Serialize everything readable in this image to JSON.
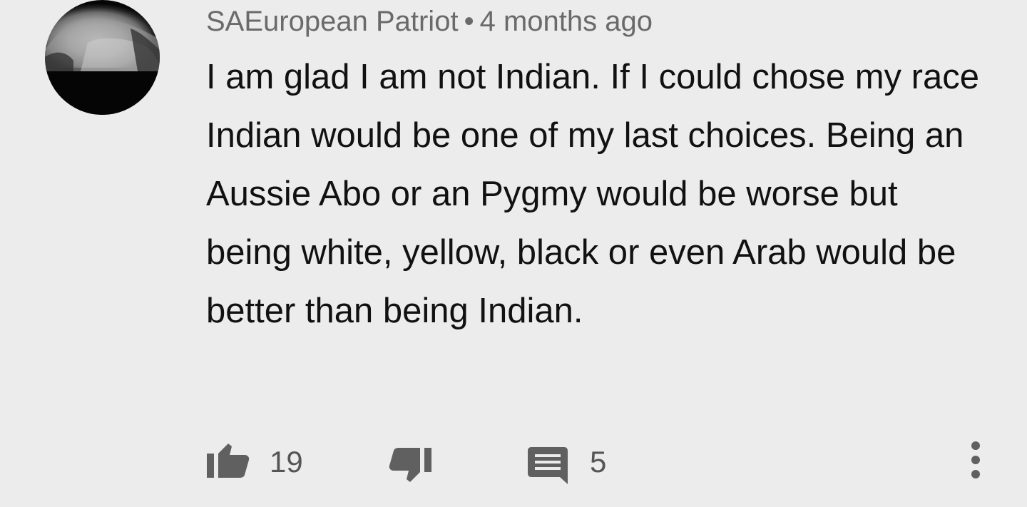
{
  "comment": {
    "author": "SAEuropean Patriot",
    "separator": "•",
    "time": "4 months ago",
    "text": "I am glad I am not Indian. If I could chose my race Indian would be one of my last choices. Being an Aussie Abo or an Pygmy would be worse but being white, yellow, black or even Arab would be better than being Indian.",
    "likes": "19",
    "replies": "5"
  },
  "icons": {
    "avatar": "avatar-image",
    "like": "thumbs-up-icon",
    "dislike": "thumbs-down-icon",
    "reply": "comment-icon",
    "more": "more-vertical-icon"
  },
  "colors": {
    "background": "#ececec",
    "text": "#111111",
    "meta": "#6a6a6a",
    "icon": "#606060"
  }
}
